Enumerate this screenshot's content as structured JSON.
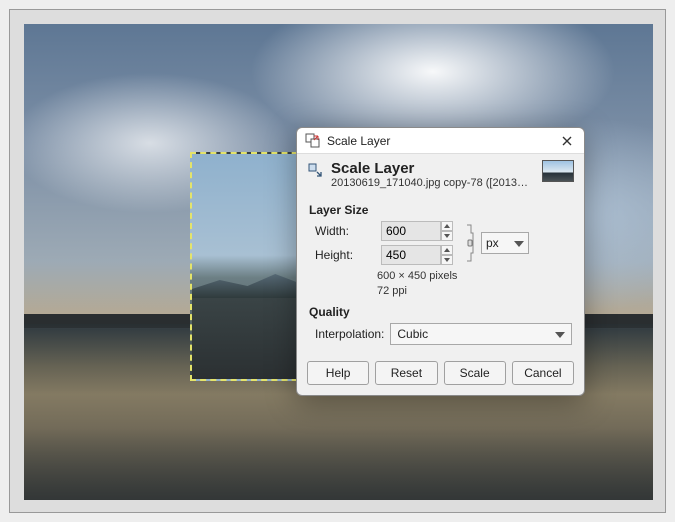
{
  "window": {
    "title": "Scale Layer"
  },
  "header": {
    "heading": "Scale Layer",
    "subtitle": "20130619_171040.jpg copy-78 ([20130701_…"
  },
  "size": {
    "section": "Layer Size",
    "width_label": "Width:",
    "height_label": "Height:",
    "width": "600",
    "height": "450",
    "unit": "px",
    "info_dims": "600 × 450 pixels",
    "info_ppi": "72 ppi"
  },
  "quality": {
    "section": "Quality",
    "interp_label": "Interpolation:",
    "interp_value": "Cubic"
  },
  "buttons": {
    "help": "Help",
    "reset": "Reset",
    "scale": "Scale",
    "cancel": "Cancel"
  }
}
